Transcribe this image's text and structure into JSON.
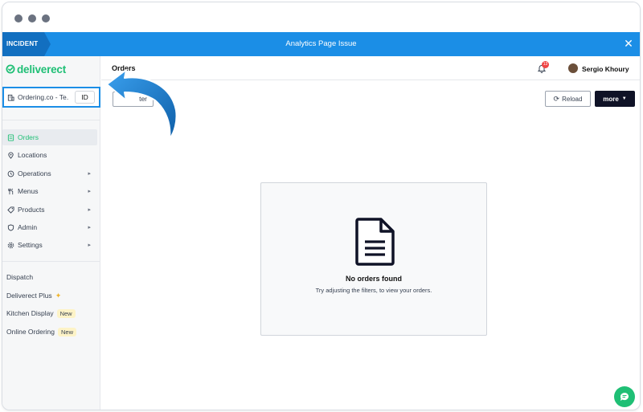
{
  "incident": {
    "tag": "INCIDENT",
    "title": "Analytics Page Issue",
    "close_label": "✕"
  },
  "sidebar": {
    "brand": "deliverect",
    "brand_color": "#1fbf75",
    "account": {
      "label": "Ordering.co - Te...",
      "id_label": "ID"
    },
    "nav_items": [
      {
        "label": "Orders",
        "icon": "orders-icon",
        "active": true,
        "has_submenu": false
      },
      {
        "label": "Locations",
        "icon": "location-pin-icon",
        "active": false,
        "has_submenu": false
      },
      {
        "label": "Operations",
        "icon": "operations-icon",
        "active": false,
        "has_submenu": true
      },
      {
        "label": "Menus",
        "icon": "cutlery-icon",
        "active": false,
        "has_submenu": true
      },
      {
        "label": "Products",
        "icon": "tag-icon",
        "active": false,
        "has_submenu": true
      },
      {
        "label": "Admin",
        "icon": "shield-icon",
        "active": false,
        "has_submenu": true
      },
      {
        "label": "Settings",
        "icon": "gear-icon",
        "active": false,
        "has_submenu": true
      }
    ],
    "extra_items": [
      {
        "label": "Dispatch"
      },
      {
        "label": "Deliverect Plus",
        "sparkle": "✦"
      },
      {
        "label": "Kitchen Display",
        "badge": "New"
      },
      {
        "label": "Online Ordering",
        "badge": "New"
      }
    ]
  },
  "header": {
    "page_title": "Orders",
    "notification_count": "13",
    "user_name": "Sergio Khoury"
  },
  "toolbar": {
    "filter_label": "ter",
    "reload_label": "Reload",
    "more_label": "more"
  },
  "empty_state": {
    "title": "No orders found",
    "subtitle": "Try adjusting the filters, to view your orders."
  },
  "colors": {
    "incident_bar": "#1b8ee6",
    "accent_green": "#1fbf75",
    "more_button": "#0f1226",
    "badge_red": "#ef4444"
  }
}
